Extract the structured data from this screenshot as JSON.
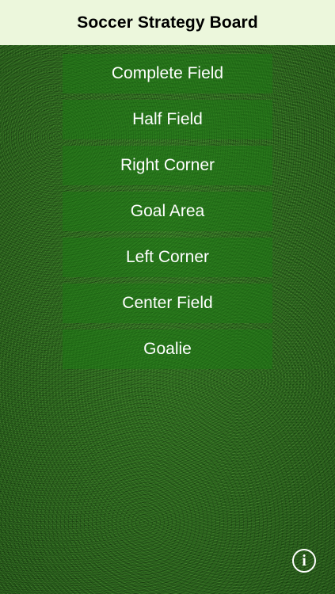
{
  "header": {
    "title": "Soccer Strategy Board"
  },
  "menu": {
    "items": [
      {
        "label": "Complete Field"
      },
      {
        "label": "Half Field"
      },
      {
        "label": "Right Corner"
      },
      {
        "label": "Goal Area"
      },
      {
        "label": "Left Corner"
      },
      {
        "label": "Center Field"
      },
      {
        "label": "Goalie"
      }
    ]
  },
  "footer": {
    "info_icon": "info-icon",
    "info_glyph": "i"
  },
  "colors": {
    "nav_background": "#ecf7dc",
    "field_green": "#2a6a1c",
    "button_green": "#2c7a1f",
    "text_on_field": "#ffffff"
  }
}
